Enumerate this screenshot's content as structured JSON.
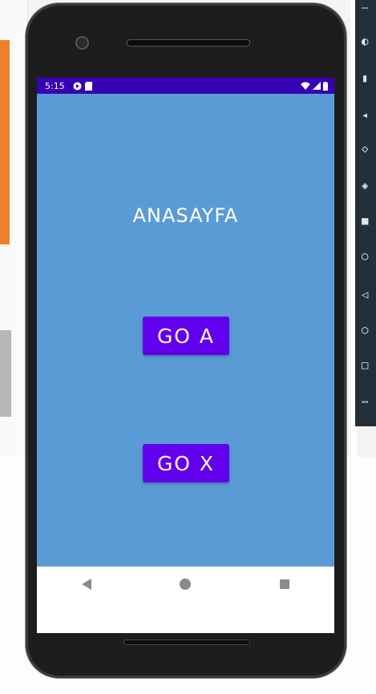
{
  "status_bar": {
    "time": "5:15",
    "left_icons": [
      "play-protect-icon",
      "sd-card-icon"
    ],
    "right_icons": [
      "wifi-icon",
      "signal-icon",
      "battery-icon"
    ]
  },
  "main": {
    "title": "ANASAYFA",
    "background_color": "#5b9bd5",
    "buttons": [
      {
        "label": "GO A"
      },
      {
        "label": "GO X"
      }
    ],
    "button_color": "#6200ee"
  },
  "navigation": {
    "icons": [
      "back-icon",
      "home-icon",
      "recents-icon"
    ]
  },
  "colors": {
    "status_bar": "#3700b3",
    "ide_accent": "#ef7f2c"
  }
}
